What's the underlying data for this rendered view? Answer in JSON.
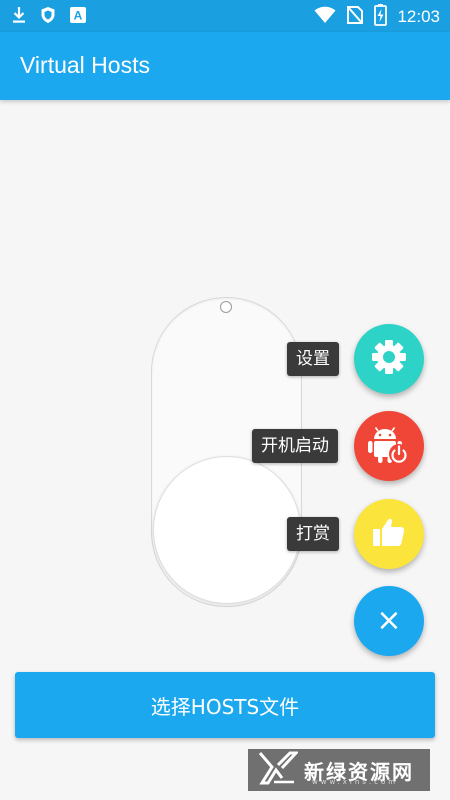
{
  "status_bar": {
    "time": "12:03",
    "left_icons": [
      "download-icon",
      "shield-icon",
      "app-a-icon"
    ],
    "right_icons": [
      "wifi-icon",
      "signal-no-sim-icon",
      "battery-charging-icon"
    ],
    "app_a_glyph": "A"
  },
  "app_bar": {
    "title": "Virtual Hosts"
  },
  "toggle": {
    "state": "off"
  },
  "fab_menu": {
    "items": [
      {
        "label": "设置",
        "icon": "gear-icon",
        "color": "#2ed3c7"
      },
      {
        "label": "开机启动",
        "icon": "android-power-icon",
        "color": "#f04637"
      },
      {
        "label": "打赏",
        "icon": "thumbs-up-icon",
        "color": "#fbe43c"
      }
    ],
    "close_icon": "close-icon",
    "close_glyph": "×",
    "close_color": "#1ca8ef"
  },
  "select_button": {
    "label": "选择HOSTS文件"
  },
  "watermark": {
    "text": "新绿资源网",
    "subtext": "www.xlhs.com"
  },
  "colors": {
    "primary": "#1ca8ef",
    "status_bar": "#1a9fe0",
    "background": "#f6f6f6"
  }
}
